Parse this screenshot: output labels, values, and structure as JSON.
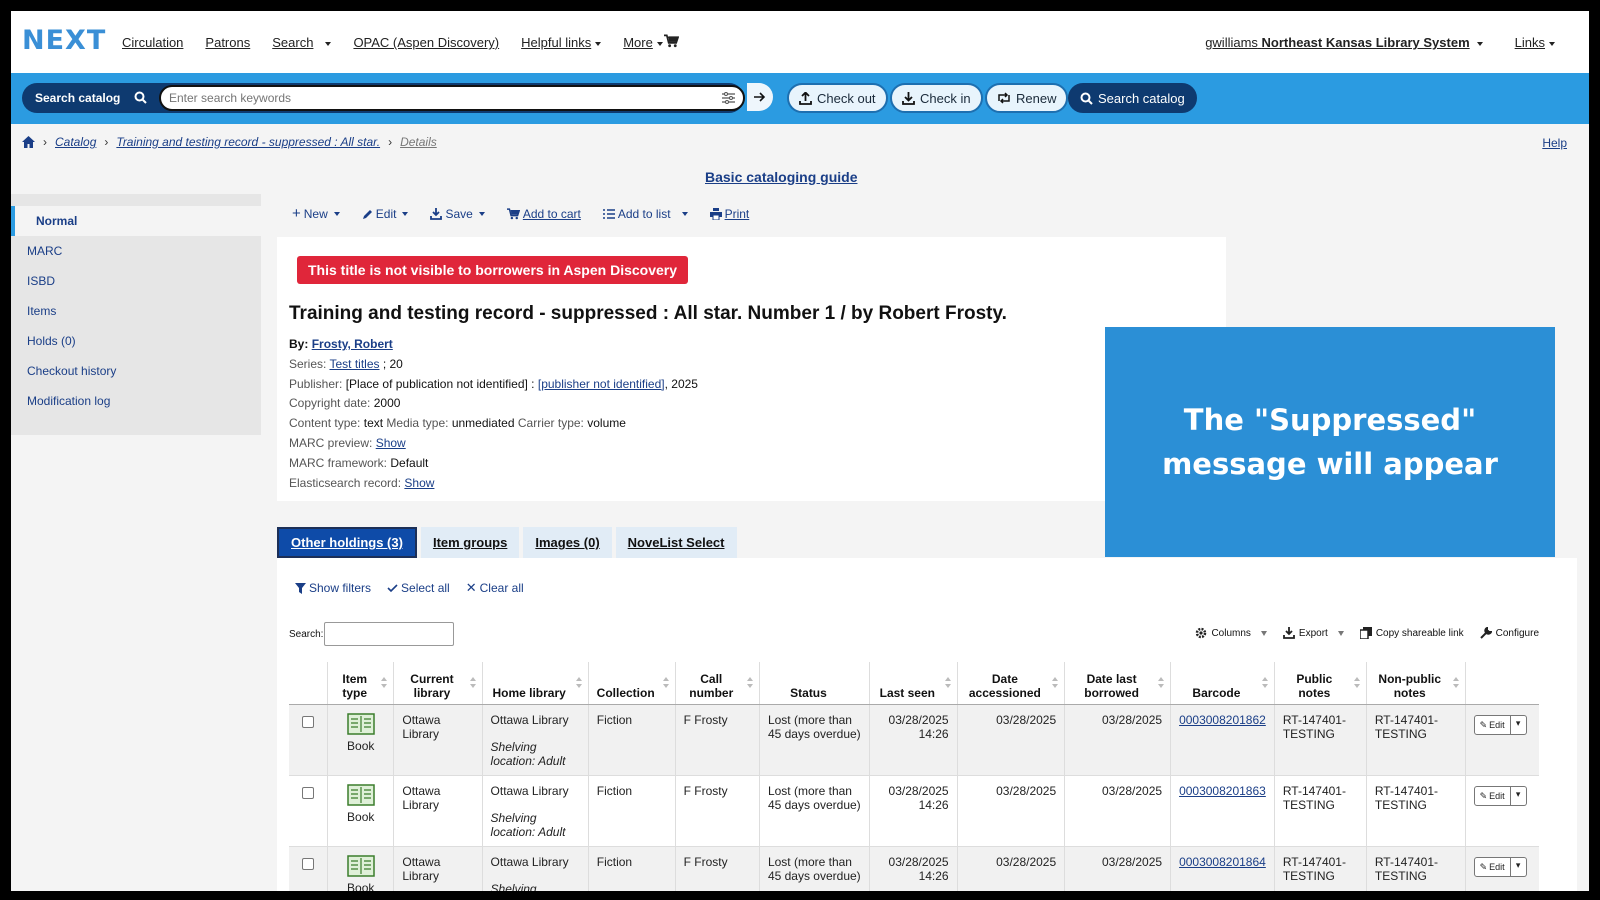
{
  "nav": {
    "logo": "NEXT",
    "links": [
      "Circulation",
      "Patrons",
      "Search",
      "OPAC (Aspen Discovery)",
      "Helpful links",
      "More"
    ],
    "user": "gwilliams",
    "library": "Northeast Kansas Library System",
    "links_menu": "Links"
  },
  "searchbar": {
    "label": "Search catalog",
    "placeholder": "Enter search keywords",
    "checkout": "Check out",
    "checkin": "Check in",
    "renew": "Renew",
    "search_catalog": "Search catalog"
  },
  "breadcrumb": {
    "catalog": "Catalog",
    "record": "Training and testing record - suppressed : All star.",
    "details": "Details"
  },
  "help": "Help",
  "guide": "Basic cataloging guide",
  "sidebar": {
    "items": [
      "Normal",
      "MARC",
      "ISBD",
      "Items",
      "Holds (0)",
      "Checkout history",
      "Modification log"
    ]
  },
  "toolbar": {
    "new": "New",
    "edit": "Edit",
    "save": "Save",
    "add_to_cart": "Add to cart",
    "add_to_list": "Add to list",
    "print": "Print"
  },
  "record": {
    "suppressed_msg": "This title is not visible to borrowers in Aspen Discovery",
    "title": "Training and testing record - suppressed : All star. Number 1 / by Robert Frosty.",
    "by_label": "By:",
    "author": "Frosty, Robert",
    "series_label": "Series:",
    "series": "Test titles",
    "series_num": "; 20",
    "publisher_label": "Publisher:",
    "publisher_place": "[Place of publication not identified] :",
    "publisher": "[publisher not identified]",
    "publisher_year": ", 2025",
    "copyright_label": "Copyright date:",
    "copyright": "2000",
    "content_label": "Content type:",
    "content": "text",
    "media_label": "Media type:",
    "media": "unmediated",
    "carrier_label": "Carrier type:",
    "carrier": "volume",
    "marc_preview_label": "MARC preview:",
    "marc_preview": "Show",
    "framework_label": "MARC framework:",
    "framework": "Default",
    "es_label": "Elasticsearch record:",
    "es": "Show"
  },
  "callout": "The \"Suppressed\" message will appear",
  "tabs": [
    "Other holdings (3)",
    "Item groups",
    "Images (0)",
    "NoveList Select"
  ],
  "holdings": {
    "show_filters": "Show filters",
    "select_all": "Select all",
    "clear_all": "Clear all",
    "search_label": "Search:",
    "columns": "Columns",
    "export": "Export",
    "copy_link": "Copy shareable link",
    "configure": "Configure",
    "headers": [
      "",
      "Item type",
      "Current library",
      "Home library",
      "Collection",
      "Call number",
      "Status",
      "Last seen",
      "Date accessioned",
      "Date last borrowed",
      "Barcode",
      "Public notes",
      "Non-public notes",
      ""
    ],
    "rows": [
      {
        "type": "Book",
        "current": "Ottawa Library",
        "home": "Ottawa Library",
        "shelf": "Shelving location: Adult",
        "collection": "Fiction",
        "call": "F Frosty",
        "status": "Lost (more than 45 days overdue)",
        "last_seen": "03/28/2025 14:26",
        "accessioned": "03/28/2025",
        "borrowed": "03/28/2025",
        "barcode": "0003008201862",
        "public": "RT-147401-TESTING",
        "nonpublic": "RT-147401-TESTING",
        "edit": "Edit"
      },
      {
        "type": "Book",
        "current": "Ottawa Library",
        "home": "Ottawa Library",
        "shelf": "Shelving location: Adult",
        "collection": "Fiction",
        "call": "F Frosty",
        "status": "Lost (more than 45 days overdue)",
        "last_seen": "03/28/2025 14:26",
        "accessioned": "03/28/2025",
        "borrowed": "03/28/2025",
        "barcode": "0003008201863",
        "public": "RT-147401-TESTING",
        "nonpublic": "RT-147401-TESTING",
        "edit": "Edit"
      },
      {
        "type": "Book",
        "current": "Ottawa Library",
        "home": "Ottawa Library",
        "shelf": "Shelving location: Adult",
        "collection": "Fiction",
        "call": "F Frosty",
        "status": "Lost (more than 45 days overdue)",
        "last_seen": "03/28/2025 14:26",
        "accessioned": "03/28/2025",
        "borrowed": "03/28/2025",
        "barcode": "0003008201864",
        "public": "RT-147401-TESTING",
        "nonpublic": "RT-147401-TESTING",
        "edit": "Edit"
      }
    ]
  },
  "colors": {
    "accent_blue": "#2b9be1",
    "dark_navy": "#0e3a70",
    "suppressed_red": "#e0263a",
    "status_red": "#c4161c",
    "callout_blue": "#2b8fd6"
  }
}
